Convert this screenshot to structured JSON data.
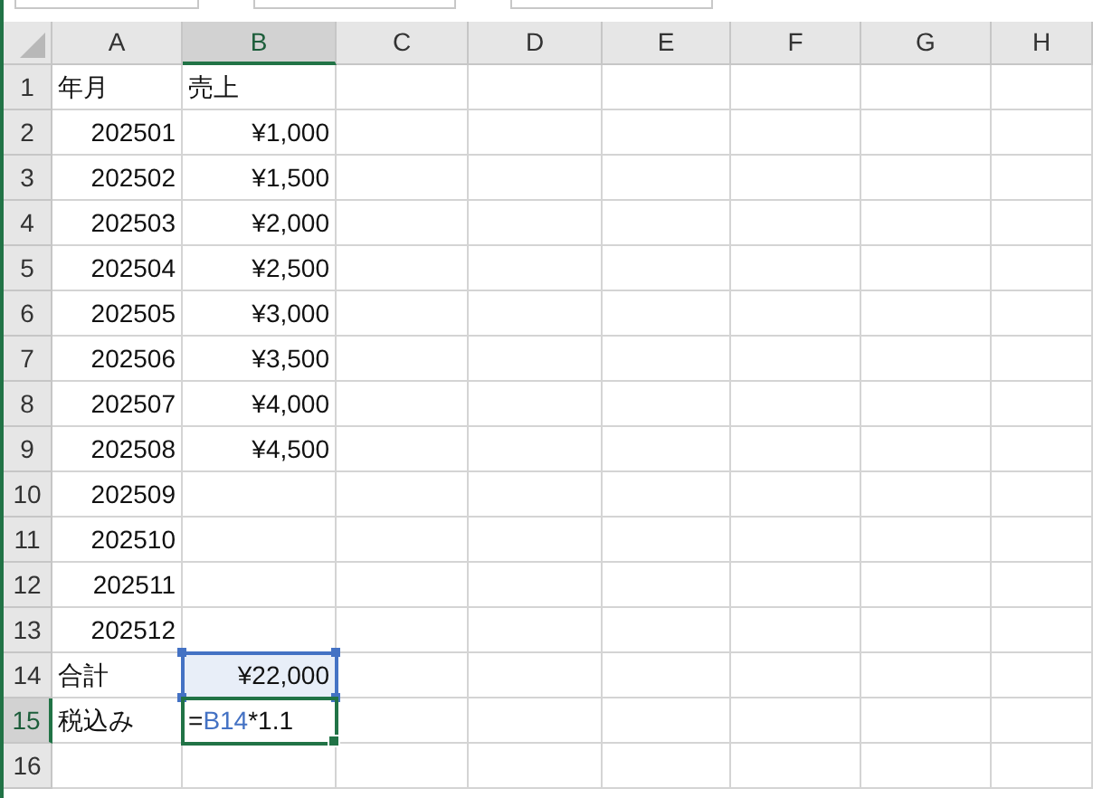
{
  "columns": [
    {
      "label": "A",
      "selected": false
    },
    {
      "label": "B",
      "selected": true
    },
    {
      "label": "C",
      "selected": false
    },
    {
      "label": "D",
      "selected": false
    },
    {
      "label": "E",
      "selected": false
    },
    {
      "label": "F",
      "selected": false
    },
    {
      "label": "G",
      "selected": false
    },
    {
      "label": "H",
      "selected": false
    }
  ],
  "rows": [
    {
      "label": "1",
      "selected": false,
      "cells": [
        {
          "kind": "text",
          "text": "年月"
        },
        {
          "kind": "text",
          "text": "売上"
        }
      ]
    },
    {
      "label": "2",
      "selected": false,
      "cells": [
        {
          "kind": "number",
          "text": "202501"
        },
        {
          "kind": "number",
          "text": "¥1,000"
        }
      ]
    },
    {
      "label": "3",
      "selected": false,
      "cells": [
        {
          "kind": "number",
          "text": "202502"
        },
        {
          "kind": "number",
          "text": "¥1,500"
        }
      ]
    },
    {
      "label": "4",
      "selected": false,
      "cells": [
        {
          "kind": "number",
          "text": "202503"
        },
        {
          "kind": "number",
          "text": "¥2,000"
        }
      ]
    },
    {
      "label": "5",
      "selected": false,
      "cells": [
        {
          "kind": "number",
          "text": "202504"
        },
        {
          "kind": "number",
          "text": "¥2,500"
        }
      ]
    },
    {
      "label": "6",
      "selected": false,
      "cells": [
        {
          "kind": "number",
          "text": "202505"
        },
        {
          "kind": "number",
          "text": "¥3,000"
        }
      ]
    },
    {
      "label": "7",
      "selected": false,
      "cells": [
        {
          "kind": "number",
          "text": "202506"
        },
        {
          "kind": "number",
          "text": "¥3,500"
        }
      ]
    },
    {
      "label": "8",
      "selected": false,
      "cells": [
        {
          "kind": "number",
          "text": "202507"
        },
        {
          "kind": "number",
          "text": "¥4,000"
        }
      ]
    },
    {
      "label": "9",
      "selected": false,
      "cells": [
        {
          "kind": "number",
          "text": "202508"
        },
        {
          "kind": "number",
          "text": "¥4,500"
        }
      ]
    },
    {
      "label": "10",
      "selected": false,
      "cells": [
        {
          "kind": "number",
          "text": "202509"
        }
      ]
    },
    {
      "label": "11",
      "selected": false,
      "cells": [
        {
          "kind": "number",
          "text": "202510"
        }
      ]
    },
    {
      "label": "12",
      "selected": false,
      "cells": [
        {
          "kind": "number",
          "text": "202511"
        }
      ]
    },
    {
      "label": "13",
      "selected": false,
      "cells": [
        {
          "kind": "number",
          "text": "202512"
        }
      ]
    },
    {
      "label": "14",
      "selected": false,
      "cells": [
        {
          "kind": "text",
          "text": "合計"
        },
        {
          "kind": "number",
          "text": "¥22,000",
          "referenced": true
        }
      ]
    },
    {
      "label": "15",
      "selected": true,
      "cells": [
        {
          "kind": "text",
          "text": "税込み"
        },
        {
          "kind": "formula",
          "selected": true,
          "parts": [
            {
              "kind": "text",
              "text": "="
            },
            {
              "kind": "ref",
              "text": "B14"
            },
            {
              "kind": "text",
              "text": "*1.1"
            }
          ]
        }
      ]
    },
    {
      "label": "16",
      "selected": false,
      "cells": []
    }
  ]
}
